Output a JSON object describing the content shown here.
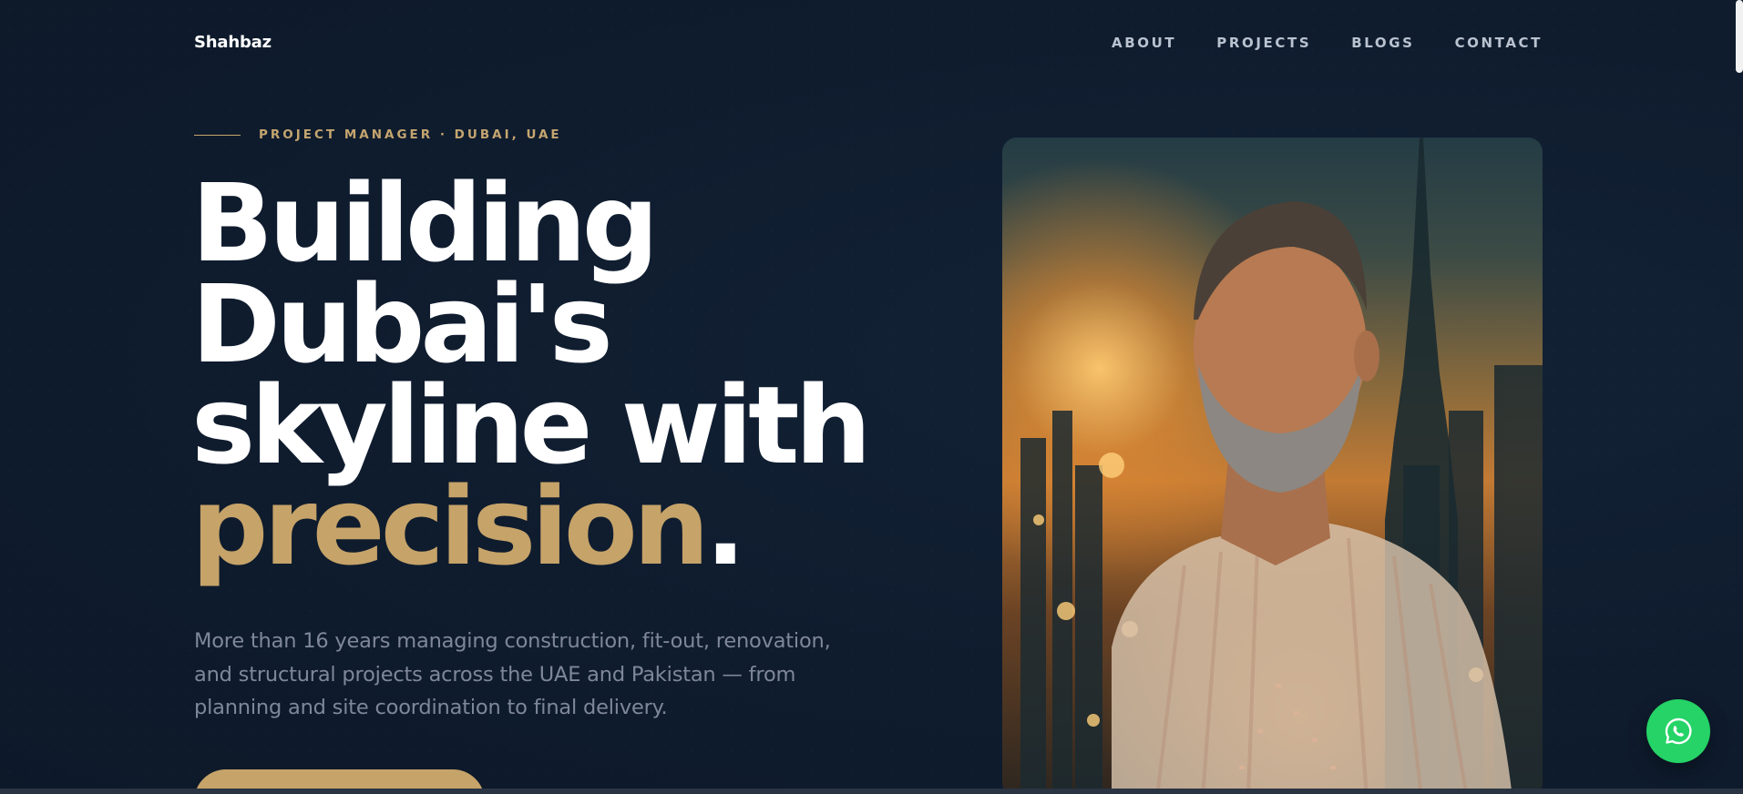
{
  "nav": {
    "logo": "Shahbaz",
    "links": [
      "ABOUT",
      "PROJECTS",
      "BLOGS",
      "CONTACT"
    ]
  },
  "hero": {
    "eyebrow": "PROJECT MANAGER · DUBAI, UAE",
    "headline": {
      "line1": "Building",
      "line2": "Dubai's",
      "line3": "skyline with",
      "accent": "precision",
      "period": "."
    },
    "lead": "More than 16 years managing construction, fit-out, renovation, and structural projects across the UAE and Pakistan — from planning and site coordination to final delivery.",
    "cta_label": ""
  },
  "portrait": {
    "alt": "Shahbaz"
  },
  "fab": {
    "icon": "whatsapp-icon"
  },
  "colors": {
    "background": "#0f1c2e",
    "accent_gold": "#c6a369",
    "text_muted": "#7e8898",
    "whatsapp_green": "#25d366"
  }
}
